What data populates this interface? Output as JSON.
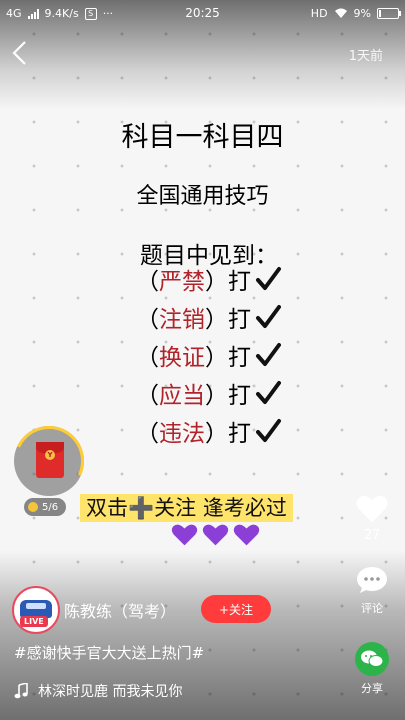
{
  "status_bar": {
    "network": "4G",
    "speed": "9.4K/s",
    "sim_badge": "S",
    "more": "···",
    "time": "20:25",
    "hd": "HD",
    "battery": "9%"
  },
  "nav": {
    "back_icon": "chevron-left-icon",
    "posted_ago": "1天前"
  },
  "post": {
    "title": "科目一科目四",
    "subtitle": "全国通用技巧",
    "lead": "题目中见到：",
    "rules": [
      {
        "open": "（",
        "word": "严禁",
        "close": "）",
        "action": "打"
      },
      {
        "open": "（",
        "word": "注销",
        "close": "）",
        "action": "打"
      },
      {
        "open": "（",
        "word": "换证",
        "close": "）",
        "action": "打"
      },
      {
        "open": "（",
        "word": "应当",
        "close": "）",
        "action": "打"
      },
      {
        "open": "（",
        "word": "违法",
        "close": "）",
        "action": "打"
      }
    ],
    "caption": "双击➕关注  逢考必过",
    "hearts": "💜💜💜"
  },
  "red_envelope": {
    "coin_label": "Y",
    "count": "5/6"
  },
  "actions": {
    "likes": "27",
    "comment_label": "评论",
    "share_label": "分享"
  },
  "author": {
    "live_badge": "LIVE",
    "name": "陈教练（驾考）",
    "follow_label": "+关注"
  },
  "hashtag": "#感谢快手官大大送上热门#",
  "music": "林深时见鹿 而我未见你",
  "colors": {
    "accent_red": "#b0232a",
    "follow": "#ff3b3b",
    "caption_highlight": "#ffe46b",
    "share_green": "#2cb34a"
  }
}
